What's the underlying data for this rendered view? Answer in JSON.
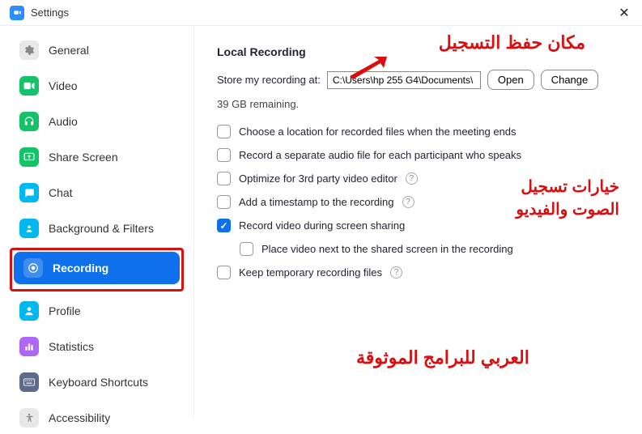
{
  "titlebar": {
    "title": "Settings"
  },
  "sidebar": {
    "items": [
      {
        "label": "General",
        "icon_color": "#e8e8e8"
      },
      {
        "label": "Video",
        "icon_color": "#14c269"
      },
      {
        "label": "Audio",
        "icon_color": "#14c269"
      },
      {
        "label": "Share Screen",
        "icon_color": "#14c269"
      },
      {
        "label": "Chat",
        "icon_color": "#00b8f0"
      },
      {
        "label": "Background & Filters",
        "icon_color": "#00b8f0"
      },
      {
        "label": "Recording",
        "icon_color": "#fff"
      },
      {
        "label": "Profile",
        "icon_color": "#00b8f0"
      },
      {
        "label": "Statistics",
        "icon_color": "#b066f5"
      },
      {
        "label": "Keyboard Shortcuts",
        "icon_color": "#5e6b8c"
      },
      {
        "label": "Accessibility",
        "icon_color": "#6b7280"
      }
    ]
  },
  "main": {
    "section_title": "Local Recording",
    "store_label": "Store my recording at:",
    "path": "C:\\Users\\hp 255 G4\\Documents\\",
    "open_btn": "Open",
    "change_btn": "Change",
    "remaining": "39 GB remaining.",
    "options": [
      {
        "label": "Choose a location for recorded files when the meeting ends",
        "checked": false,
        "help": false
      },
      {
        "label": "Record a separate audio file for each participant who speaks",
        "checked": false,
        "help": false
      },
      {
        "label": "Optimize for 3rd party video editor",
        "checked": false,
        "help": true
      },
      {
        "label": "Add a timestamp to the recording",
        "checked": false,
        "help": true
      },
      {
        "label": "Record video during screen sharing",
        "checked": true,
        "help": false
      },
      {
        "label": "Place video next to the shared screen in the recording",
        "checked": false,
        "help": false,
        "indent": true
      },
      {
        "label": "Keep temporary recording files",
        "checked": false,
        "help": true
      }
    ]
  },
  "annotations": {
    "a1": "مكان حفظ التسجيل",
    "a2": "خيارات تسجيل\nالصوت والفيديو",
    "a3": "العربي للبرامج الموثوقة"
  }
}
